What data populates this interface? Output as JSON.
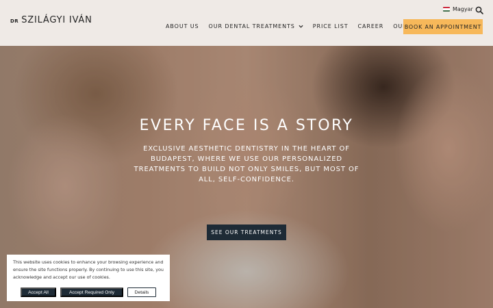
{
  "header": {
    "logo": {
      "prefix": "DR",
      "name": "SZILÁGYI IVÁN"
    },
    "language": {
      "label": "Magyar",
      "flag_colors": [
        "#cd2a3e",
        "#ffffff",
        "#436f4d"
      ]
    },
    "search_icon": "search-icon",
    "nav": [
      {
        "label": "ABOUT US"
      },
      {
        "label": "OUR DENTAL TREATMENTS",
        "has_dropdown": true
      },
      {
        "label": "PRICE LIST"
      },
      {
        "label": "CAREER"
      },
      {
        "label": "OUR CLINIC"
      }
    ],
    "book_label": "BOOK AN APPOINTMENT",
    "book_color": "#f7b85a"
  },
  "hero": {
    "title": "EVERY FACE IS A STORY",
    "subtitle": "EXCLUSIVE AESTHETIC DENTISTRY IN THE HEART OF BUDAPEST, WHERE WE USE OUR PERSONALIZED TREATMENTS TO BUILD NOT ONLY SMILES, BUT MOST OF ALL, SELF-CONFIDENCE.",
    "cta_label": "SEE OUR TREATMENTS",
    "cta_color": "#1e2b36"
  },
  "cookie": {
    "text": "This website uses cookies to enhance your browsing experience and ensure the site functions properly. By continuing to use this site, you acknowledge and accept our use of cookies.",
    "accept_all": "Accept All",
    "accept_required": "Accept Required Only",
    "details": "Details"
  }
}
